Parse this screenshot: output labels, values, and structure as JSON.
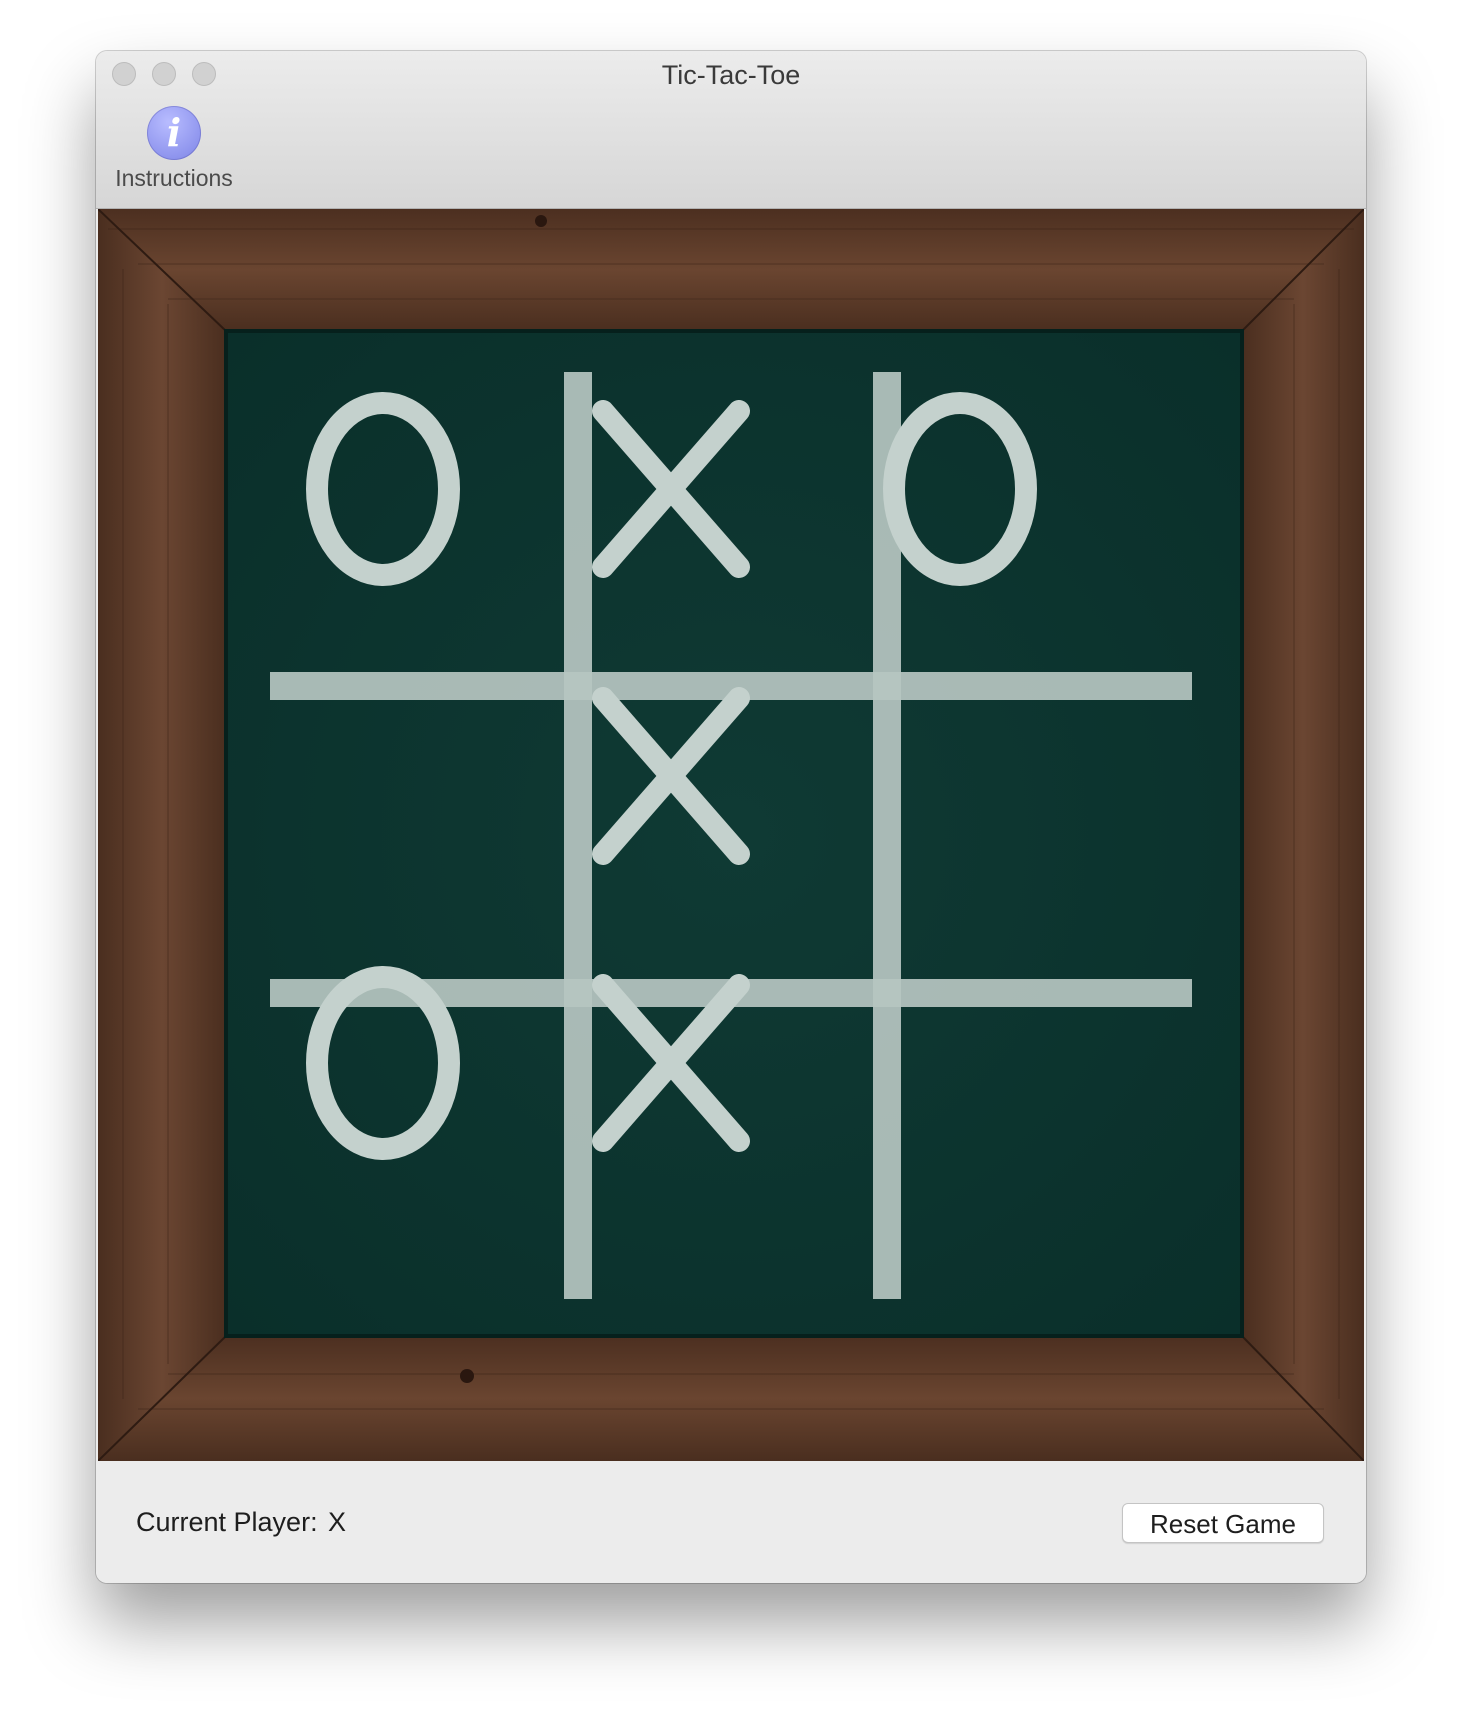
{
  "window": {
    "title": "Tic-Tac-Toe"
  },
  "toolbar": {
    "instructions_label": "Instructions",
    "instructions_icon": "info-icon"
  },
  "board": {
    "cells": [
      [
        "O",
        "X",
        "O"
      ],
      [
        "",
        "X",
        ""
      ],
      [
        "O",
        "X",
        ""
      ]
    ],
    "colors": {
      "frame_wood": "#5a3a28",
      "chalkboard": "#0d3630",
      "chalk": "#c4d1cd"
    }
  },
  "status": {
    "current_player_label": "Current Player:",
    "current_player_value": "X"
  },
  "actions": {
    "reset_label": "Reset Game"
  }
}
